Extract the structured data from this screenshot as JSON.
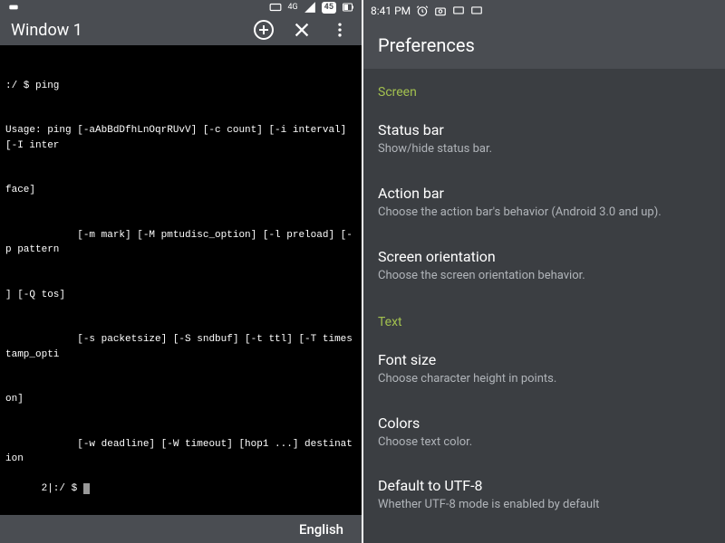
{
  "left": {
    "status": {
      "signal_text": "4G",
      "battery": "45"
    },
    "app_bar": {
      "title": "Window 1"
    },
    "terminal": {
      "lines": [
        ":/ $ ping",
        "Usage: ping [-aAbBdDfhLnOqrRUvV] [-c count] [-i interval] [-I inter",
        "face]",
        "            [-m mark] [-M pmtudisc_option] [-l preload] [-p pattern",
        "] [-Q tos]",
        "            [-s packetsize] [-S sndbuf] [-t ttl] [-T timestamp_opti",
        "on]",
        "            [-w deadline] [-W timeout] [hop1 ...] destination",
        "2|:/ $ "
      ]
    },
    "bottom_bar": {
      "label": "English"
    }
  },
  "right": {
    "status": {
      "time": "8:41 PM"
    },
    "title": "Preferences",
    "sections": [
      {
        "header": "Screen",
        "items": [
          {
            "title": "Status bar",
            "sub": "Show/hide status bar."
          },
          {
            "title": "Action bar",
            "sub": "Choose the action bar's behavior (Android 3.0 and up)."
          },
          {
            "title": "Screen orientation",
            "sub": "Choose the screen orientation behavior."
          }
        ]
      },
      {
        "header": "Text",
        "items": [
          {
            "title": "Font size",
            "sub": "Choose character height in points."
          },
          {
            "title": "Colors",
            "sub": "Choose text color."
          },
          {
            "title": "Default to UTF-8",
            "sub": "Whether UTF-8 mode is enabled by default"
          }
        ]
      }
    ]
  }
}
